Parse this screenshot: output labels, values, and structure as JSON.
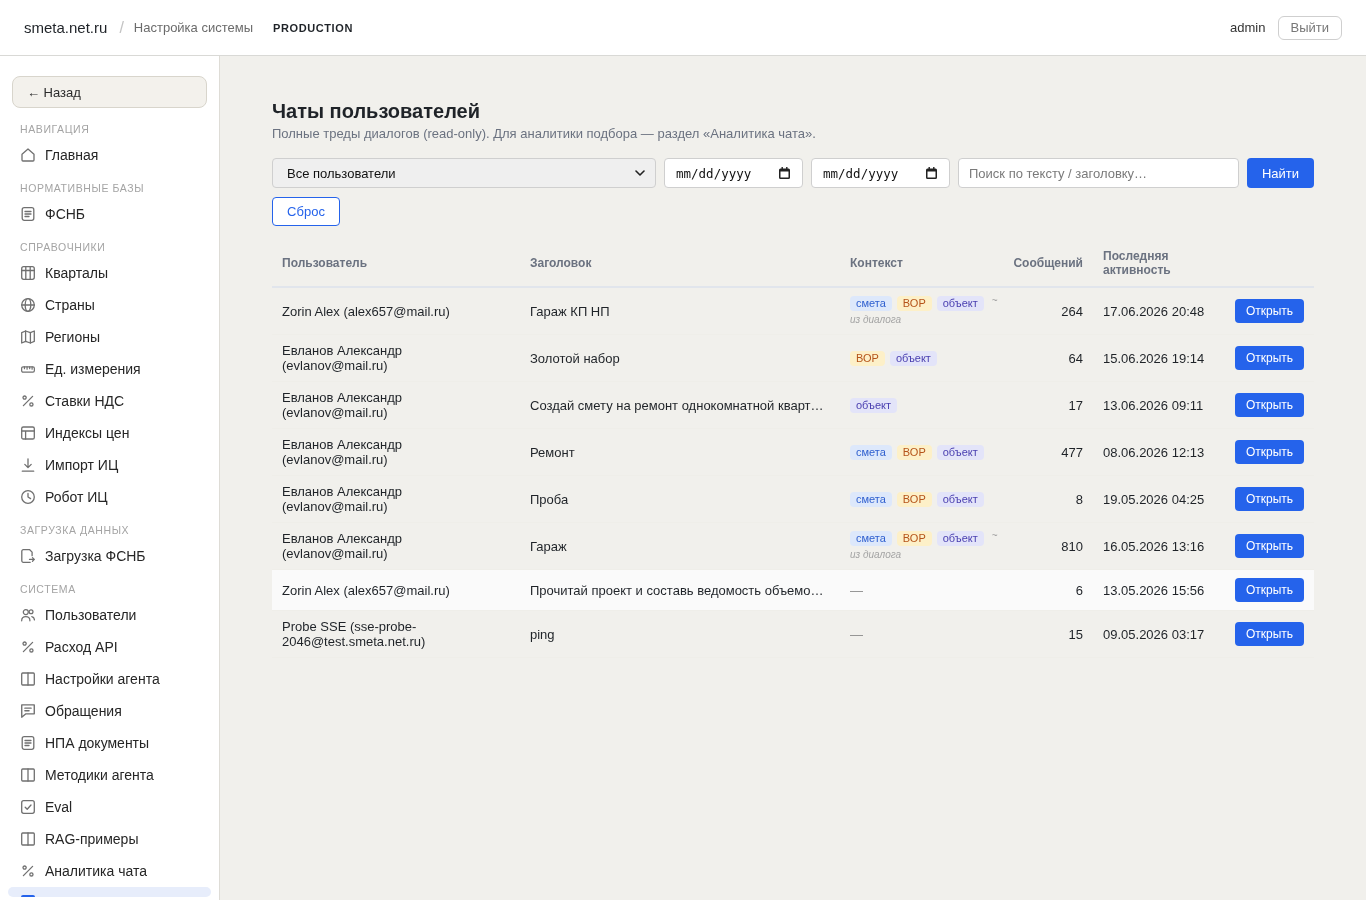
{
  "header": {
    "brand": "smeta.net.ru",
    "separator": "/",
    "section": "Настройка системы",
    "environment": "PRODUCTION",
    "user": "admin",
    "logout": "Выйти"
  },
  "sidebar": {
    "back": "← Назад",
    "groups": [
      {
        "title": "НАВИГАЦИЯ",
        "items": [
          {
            "label": "Главная",
            "selected": false
          }
        ]
      },
      {
        "title": "НОРМАТИВНЫЕ БАЗЫ",
        "items": [
          {
            "label": "ФСНБ",
            "selected": false
          }
        ]
      },
      {
        "title": "СПРАВОЧНИКИ",
        "items": [
          {
            "label": "Кварталы",
            "selected": false
          },
          {
            "label": "Страны",
            "selected": false
          },
          {
            "label": "Регионы",
            "selected": false
          },
          {
            "label": "Ед. измерения",
            "selected": false
          },
          {
            "label": "Ставки НДС",
            "selected": false
          },
          {
            "label": "Индексы цен",
            "selected": false
          },
          {
            "label": "Импорт ИЦ",
            "selected": false
          },
          {
            "label": "Робот ИЦ",
            "selected": false
          }
        ]
      },
      {
        "title": "ЗАГРУЗКА ДАННЫХ",
        "items": [
          {
            "label": "Загрузка ФСНБ",
            "selected": false
          }
        ]
      },
      {
        "title": "СИСТЕМА",
        "items": [
          {
            "label": "Пользователи",
            "selected": false
          },
          {
            "label": "Расход API",
            "selected": false
          },
          {
            "label": "Настройки агента",
            "selected": false
          },
          {
            "label": "Обращения",
            "selected": false
          },
          {
            "label": "НПА документы",
            "selected": false
          },
          {
            "label": "Методики агента",
            "selected": false
          },
          {
            "label": "Eval",
            "selected": false
          },
          {
            "label": "RAG-примеры",
            "selected": false
          },
          {
            "label": "Аналитика чата",
            "selected": false
          },
          {
            "selected": true
          }
        ]
      }
    ]
  },
  "page": {
    "title": "Чаты пользователей",
    "subtitle": "Полные треды диалогов (read-only). Для аналитики подбора — раздел «Аналитика чата»."
  },
  "filters": {
    "user_select": "Все пользователи",
    "date_from": {
      "placeholder": "mm/dd/yyyy"
    },
    "date_to": {
      "placeholder": "mm/dd/yyyy"
    },
    "search": {
      "placeholder": "Поиск по тексту / заголовку…"
    },
    "find": "Найти",
    "reset": "Сброс"
  },
  "table": {
    "columns": [
      "Пользователь",
      "Заголовок",
      "Контекст",
      "Сообщений",
      "Последняя активность"
    ],
    "rows": [
      {
        "user": "Zorin Alex (alex657@mail.ru)",
        "title": "Гараж КП НП",
        "context": {
          "tags": [
            {
              "label": "смета",
              "kind": "estimate"
            },
            {
              "label": "ВОР",
              "kind": "boq"
            },
            {
              "label": "объект",
              "kind": "object"
            }
          ],
          "approx": "~",
          "source": "из диалога"
        },
        "messages": "264",
        "last_activity": "17.06.2026 20:48",
        "action": "Открыть",
        "hovered": false
      },
      {
        "user": "Евланов Александр (evlanov@mail.ru)",
        "title": "Золотой набор",
        "context": {
          "tags": [
            {
              "label": "ВОР",
              "kind": "boq"
            },
            {
              "label": "объект",
              "kind": "object"
            }
          ]
        },
        "messages": "64",
        "last_activity": "15.06.2026 19:14",
        "action": "Открыть",
        "hovered": false
      },
      {
        "user": "Евланов Александр (evlanov@mail.ru)",
        "title": "Создай смету на ремонт однокомнатной кварт…",
        "context": {
          "tags": [
            {
              "label": "объект",
              "kind": "object"
            }
          ]
        },
        "messages": "17",
        "last_activity": "13.06.2026 09:11",
        "action": "Открыть",
        "hovered": false
      },
      {
        "user": "Евланов Александр (evlanov@mail.ru)",
        "title": "Ремонт",
        "context": {
          "tags": [
            {
              "label": "смета",
              "kind": "estimate"
            },
            {
              "label": "ВОР",
              "kind": "boq"
            },
            {
              "label": "объект",
              "kind": "object"
            }
          ]
        },
        "messages": "477",
        "last_activity": "08.06.2026 12:13",
        "action": "Открыть",
        "hovered": false
      },
      {
        "user": "Евланов Александр (evlanov@mail.ru)",
        "title": "Проба",
        "context": {
          "tags": [
            {
              "label": "смета",
              "kind": "estimate"
            },
            {
              "label": "ВОР",
              "kind": "boq"
            },
            {
              "label": "объект",
              "kind": "object"
            }
          ]
        },
        "messages": "8",
        "last_activity": "19.05.2026 04:25",
        "action": "Открыть",
        "hovered": false
      },
      {
        "user": "Евланов Александр (evlanov@mail.ru)",
        "title": "Гараж",
        "context": {
          "tags": [
            {
              "label": "смета",
              "kind": "estimate"
            },
            {
              "label": "ВОР",
              "kind": "boq"
            },
            {
              "label": "объект",
              "kind": "object"
            }
          ],
          "approx": "~",
          "source": "из диалога"
        },
        "messages": "810",
        "last_activity": "16.05.2026 13:16",
        "action": "Открыть",
        "hovered": false
      },
      {
        "user": "Zorin Alex (alex657@mail.ru)",
        "title": "Прочитай проект и составь ведомость объемо…",
        "context": {
          "empty": "—"
        },
        "messages": "6",
        "last_activity": "13.05.2026 15:56",
        "action": "Открыть",
        "hovered": true
      },
      {
        "user": "Probe SSE (sse-probe-2046@test.smeta.net.ru)",
        "title": "ping",
        "context": {
          "empty": "—"
        },
        "messages": "15",
        "last_activity": "09.05.2026 03:17",
        "action": "Открыть",
        "hovered": false
      }
    ]
  }
}
